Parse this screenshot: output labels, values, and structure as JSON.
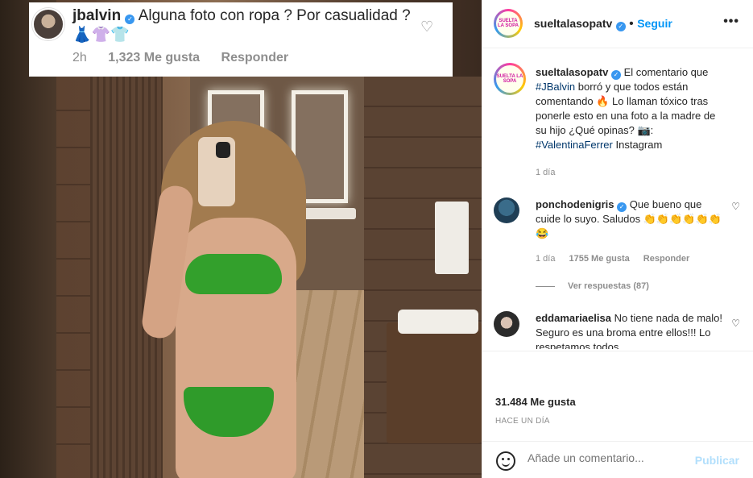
{
  "overlay_comment": {
    "username": "jbalvin",
    "text": "Alguna foto con ropa ? Por casualidad ?👗👚👕",
    "time": "2h",
    "likes": "1,323 Me gusta",
    "reply": "Responder"
  },
  "header": {
    "account": "sueltalasopatv",
    "follow": "Seguir",
    "logo_text": "SUELTA LA SOPA"
  },
  "caption": {
    "username": "sueltalasopatv",
    "text_part1": "El comentario que",
    "tag1": "#JBalvin",
    "text_part2": "borró y que todos están comentando 🔥 Lo llaman tóxico tras ponerle esto en una foto a la madre de su hijo ¿Qué opinas? 📷:",
    "tag2": "#ValentinaFerrer",
    "text_part3": "Instagram",
    "time": "1 día"
  },
  "comments": [
    {
      "username": "ponchodenigris",
      "text": "Que bueno que cuide lo suyo. Saludos 👏👏👏👏👏👏😂",
      "time": "1 día",
      "likes": "1755 Me gusta",
      "reply": "Responder",
      "view_replies": "Ver respuestas (87)"
    },
    {
      "username": "eddamariaelisa",
      "text": "No tiene nada de malo! Seguro es una broma entre ellos!!! Lo respetamos todos"
    }
  ],
  "likes_count": "31.484 Me gusta",
  "posted_ago": "HACE UN DÍA",
  "add_comment": {
    "placeholder": "Añade un comentario...",
    "publish": "Publicar"
  }
}
